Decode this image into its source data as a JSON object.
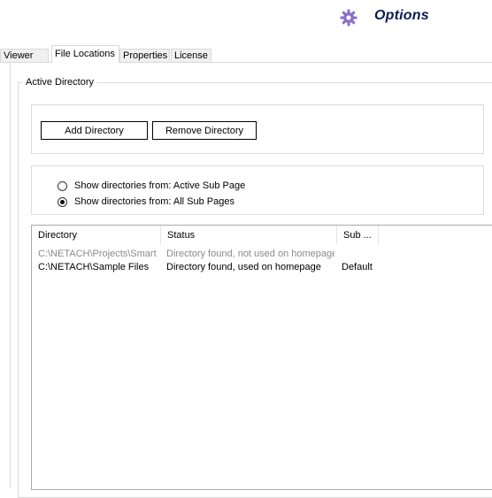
{
  "header": {
    "title": "Options",
    "icon": "gear-icon"
  },
  "tabs": [
    {
      "label": "Viewer",
      "active": false
    },
    {
      "label": "File Locations",
      "active": true
    },
    {
      "label": "Properties",
      "active": false
    },
    {
      "label": "License",
      "active": false
    }
  ],
  "group": {
    "label": "Active Directory"
  },
  "buttons": {
    "add": "Add Directory",
    "remove": "Remove Directory"
  },
  "radios": [
    {
      "label": "Show directories from: Active Sub Page",
      "checked": false
    },
    {
      "label": "Show directories from: All Sub Pages",
      "checked": true
    }
  ],
  "list": {
    "columns": [
      "Directory",
      "Status",
      "Sub ..."
    ],
    "rows": [
      {
        "directory": "C:\\NETACH\\Projects\\Smart",
        "status": "Directory found, not used on homepage",
        "sub": "",
        "dimmed": true
      },
      {
        "directory": "C:\\NETACH\\Sample Files",
        "status": "Directory found, used on homepage",
        "sub": "Default",
        "dimmed": false
      }
    ]
  },
  "colors": {
    "title": "#0a1a55",
    "gear": "#8a6fc8",
    "dimmed_row": "#8a8a8a"
  }
}
